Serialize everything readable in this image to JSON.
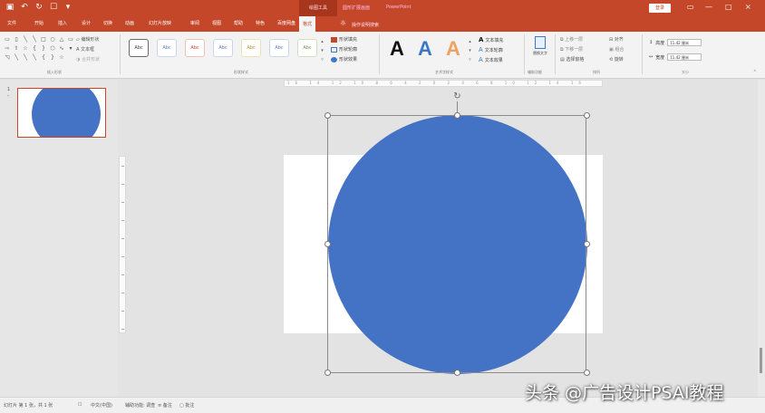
{
  "titlebar": {
    "context_group": "绘图工具",
    "doc_title": "圆形扩展画面",
    "app_name": "PowerPoint",
    "signin": "登录",
    "min": "—",
    "restore": "□",
    "close": "×"
  },
  "tabs": [
    "文件",
    "开始",
    "插入",
    "设计",
    "切换",
    "动画",
    "幻灯片放映",
    "审阅",
    "视图",
    "帮助",
    "特色",
    "百度网盘",
    "格式"
  ],
  "tell_me": "操作说明搜索",
  "ribbon": {
    "groups": {
      "insert_shapes": "插入形状",
      "shape_styles": "形状样式",
      "wordart_styles": "艺术字样式",
      "accessibility": "辅助功能",
      "arrange": "排列",
      "size": "大小"
    },
    "edit_shape": "编辑形状",
    "text_box": "文本框",
    "merge_shapes": "合并形状",
    "style_label": "Abc",
    "shape_fill": "形状填充",
    "shape_outline": "形状轮廓",
    "shape_effects": "形状效果",
    "wordart_letter": "A",
    "text_fill": "文本填充",
    "text_outline": "文本轮廓",
    "text_effects": "文本效果",
    "alt_text": "替换文字",
    "bring_forward": "上移一层",
    "send_backward": "下移一层",
    "selection_pane": "选择窗格",
    "align": "对齐",
    "group": "组合",
    "rotate": "旋转",
    "height_label": "高度",
    "height_value": "11.42 厘米",
    "width_label": "宽度",
    "width_value": "11.42 厘米"
  },
  "slides": {
    "number": "1",
    "star": "*"
  },
  "canvas": {
    "circle_color": "#4472C4",
    "rotate_icon": "↻"
  },
  "ruler": {
    "h_text": "16 14 12 10 8 6 4 2 0 2 4 6 8 10 12 14 16"
  },
  "statusbar": {
    "slide_info": "幻灯片 第 1 张，共 1 张",
    "language": "中文(中国)",
    "accessibility": "辅助功能: 调查",
    "notes": "备注",
    "comments": "批注"
  },
  "watermark": "头条 @广告设计PSAI教程"
}
